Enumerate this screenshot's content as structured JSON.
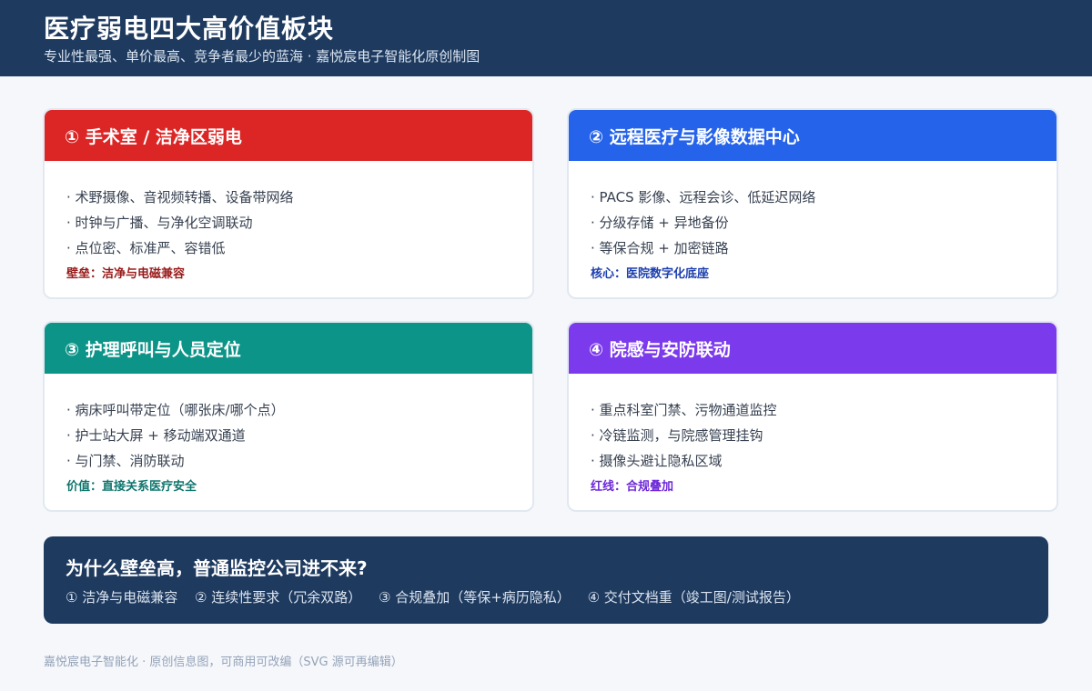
{
  "header": {
    "title": "医疗弱电四大高价值板块",
    "subtitle": "专业性最强、单价最高、竞争者最少的蓝海 · 嘉悦宸电子智能化原创制图"
  },
  "cards": [
    {
      "title": "① 手术室 / 洁净区弱电",
      "color": "#dc2626",
      "items": [
        "· 术野摄像、音视频转播、设备带网络",
        "· 时钟与广播、与净化空调联动",
        "· 点位密、标准严、容错低"
      ],
      "note": "壁垒：洁净与电磁兼容"
    },
    {
      "title": "② 远程医疗与影像数据中心",
      "color": "#2563eb",
      "items": [
        "· PACS 影像、远程会诊、低延迟网络",
        "· 分级存储 + 异地备份",
        "· 等保合规 + 加密链路"
      ],
      "note": "核心：医院数字化底座"
    },
    {
      "title": "③ 护理呼叫与人员定位",
      "color": "#0d9488",
      "items": [
        "· 病床呼叫带定位（哪张床/哪个点）",
        "· 护士站大屏 + 移动端双通道",
        "· 与门禁、消防联动"
      ],
      "note": "价值：直接关系医疗安全"
    },
    {
      "title": "④ 院感与安防联动",
      "color": "#7c3aed",
      "items": [
        "· 重点科室门禁、污物通道监控",
        "· 冷链监测，与院感管理挂钩",
        "· 摄像头避让隐私区域"
      ],
      "note": "红线：合规叠加"
    }
  ],
  "why": {
    "title": "为什么壁垒高，普通监控公司进不来?",
    "points": [
      "① 洁净与电磁兼容",
      "② 连续性要求（冗余双路）",
      "③ 合规叠加（等保+病历隐私）",
      "④ 交付文档重（竣工图/测试报告）"
    ]
  },
  "footer": "嘉悦宸电子智能化 · 原创信息图，可商用可改编（SVG 源可再编辑）"
}
